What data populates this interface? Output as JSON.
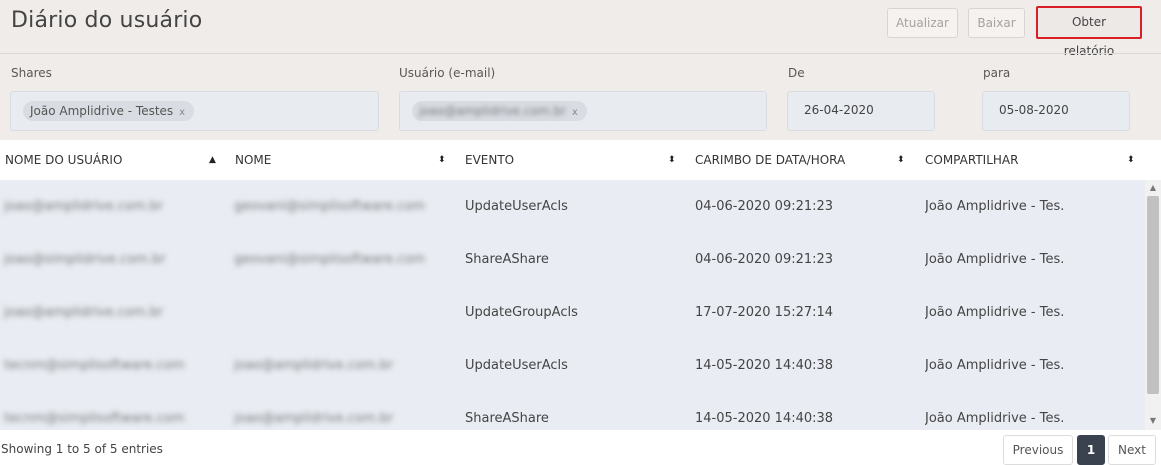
{
  "page": {
    "title": "Diário do usuário"
  },
  "toolbar": {
    "refresh_label": "Atualizar",
    "download_label": "Baixar",
    "report_label": "Obter relatório"
  },
  "filters": {
    "shares": {
      "label": "Shares",
      "chip": "João Amplidrive - Testes",
      "remove": "x"
    },
    "user": {
      "label": "Usuário (e-mail)",
      "chip": "joao@amplidrive.com.br",
      "remove": "x"
    },
    "from": {
      "label": "De",
      "value": "26-04-2020"
    },
    "to": {
      "label": "para",
      "value": "05-08-2020"
    }
  },
  "table": {
    "columns": [
      {
        "label": "NOME DO USUÁRIO",
        "sort": "▲"
      },
      {
        "label": "NOME",
        "sort": "⬍"
      },
      {
        "label": "EVENTO",
        "sort": "⬍"
      },
      {
        "label": "CARIMBO DE DATA/HORA",
        "sort": "⬍"
      },
      {
        "label": "COMPARTILHAR",
        "sort": "⬍"
      }
    ],
    "rows": [
      {
        "user": "joao@amplidrive.com.br",
        "name": "geovani@simplisoftware.com",
        "event": "UpdateUserAcls",
        "timestamp": "04-06-2020 09:21:23",
        "share": "João Amplidrive - Tes..."
      },
      {
        "user": "joao@simplidrive.com.br",
        "name": "geovani@simplisoftware.com",
        "event": "ShareAShare",
        "timestamp": "04-06-2020 09:21:23",
        "share": "João Amplidrive - Tes..."
      },
      {
        "user": "joao@amplidrive.com.br",
        "name": "",
        "event": "UpdateGroupAcls",
        "timestamp": "17-07-2020 15:27:14",
        "share": "João Amplidrive - Tes..."
      },
      {
        "user": "tecnm@simplisoftware.com",
        "name": "joao@amplidrive.com.br",
        "event": "UpdateUserAcls",
        "timestamp": "14-05-2020 14:40:38",
        "share": "João Amplidrive - Tes..."
      },
      {
        "user": "tecnm@simplisoftware.com",
        "name": "joao@amplidrive.com.br",
        "event": "ShareAShare",
        "timestamp": "14-05-2020 14:40:38",
        "share": "João Amplidrive - Tes..."
      }
    ]
  },
  "footer": {
    "info": "Showing 1 to 5 of 5 entries",
    "prev_label": "Previous",
    "page": "1",
    "next_label": "Next"
  },
  "scrollbar": {
    "up": "▲",
    "down": "▼"
  },
  "colors": {
    "accent_border": "#d81f26",
    "header_bg": "#f0ecea",
    "table_body_bg": "#e9edf3",
    "active_page": "#3a4250"
  }
}
